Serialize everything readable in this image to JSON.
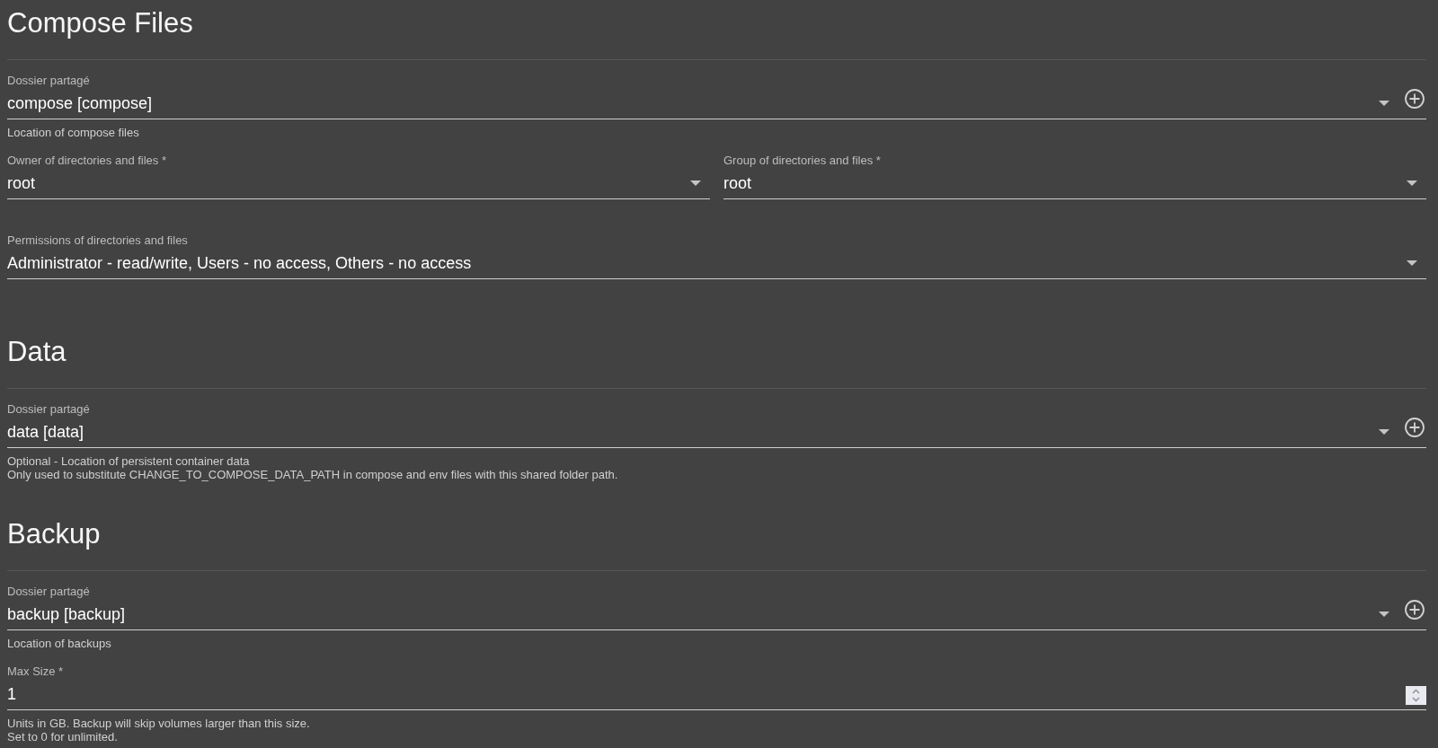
{
  "sections": [
    {
      "title": "Compose Files",
      "rows": [
        {
          "fields": [
            {
              "kind": "folder",
              "label": "Dossier partagé",
              "value": "compose [compose]",
              "hints": [
                "Location of compose files"
              ]
            }
          ]
        },
        {
          "fields": [
            {
              "kind": "select",
              "label": "Owner of directories and files *",
              "value": "root"
            },
            {
              "kind": "select",
              "label": "Group of directories and files *",
              "value": "root"
            }
          ]
        },
        {
          "fields": [
            {
              "kind": "select",
              "label": "Permissions of directories and files",
              "value": "Administrator - read/write, Users - no access, Others - no access"
            }
          ]
        }
      ]
    },
    {
      "title": "Data",
      "rows": [
        {
          "fields": [
            {
              "kind": "folder",
              "label": "Dossier partagé",
              "value": "data [data]",
              "hints": [
                "Optional - Location of persistent container data",
                "Only used to substitute CHANGE_TO_COMPOSE_DATA_PATH in compose and env files with this shared folder path."
              ]
            }
          ]
        }
      ]
    },
    {
      "title": "Backup",
      "rows": [
        {
          "fields": [
            {
              "kind": "folder",
              "label": "Dossier partagé",
              "value": "backup [backup]",
              "hints": [
                "Location of backups"
              ]
            }
          ]
        },
        {
          "fields": [
            {
              "kind": "number",
              "label": "Max Size *",
              "value": "1",
              "hints": [
                "Units in GB. Backup will skip volumes larger than this size.",
                "Set to 0 for unlimited."
              ]
            }
          ]
        }
      ]
    }
  ]
}
